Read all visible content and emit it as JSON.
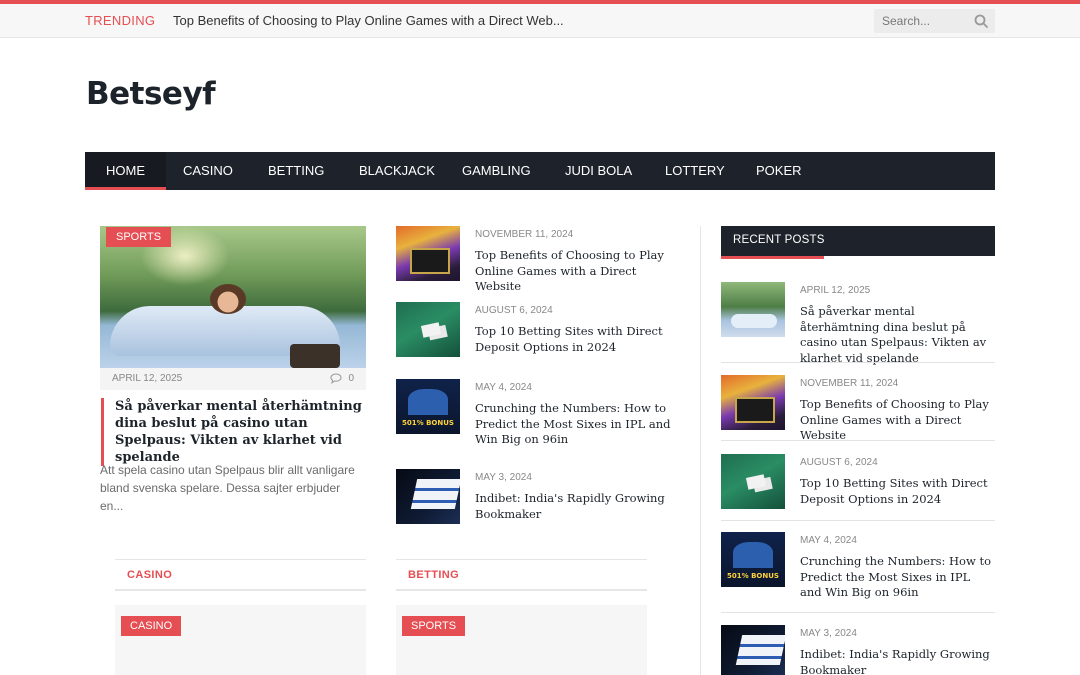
{
  "topbar": {
    "trending_label": "TRENDING",
    "trending_text": "Top Benefits of Choosing to Play Online Games with a Direct Web...",
    "search_placeholder": "Search..."
  },
  "site": {
    "logo": "Betseyf"
  },
  "nav": {
    "items": [
      "HOME",
      "CASINO",
      "BETTING",
      "BLACKJACK",
      "GAMBLING",
      "JUDI BOLA",
      "LOTTERY",
      "POKER"
    ],
    "active": "HOME"
  },
  "featured": {
    "category": "SPORTS",
    "date": "APRIL 12, 2025",
    "comments": "0",
    "title": "Så påverkar mental återhämtning dina beslut på casino utan Spelpaus: Vikten av klarhet vid spelande",
    "excerpt": "Att spela casino utan Spelpaus blir allt vanligare bland svenska spelare. Dessa sajter erbjuder en..."
  },
  "middle_posts": [
    {
      "date": "NOVEMBER 11, 2024",
      "title": "Top Benefits of Choosing to Play Online Games with a Direct Website",
      "thumb": "games"
    },
    {
      "date": "AUGUST 6, 2024",
      "title": "Top 10 Betting Sites with Direct Deposit Options in 2024",
      "thumb": "table"
    },
    {
      "date": "MAY 4, 2024",
      "title": "Crunching the Numbers: How to Predict the Most Sixes in IPL and Win Big on 96in",
      "thumb": "ipl"
    },
    {
      "date": "MAY 3, 2024",
      "title": "Indibet: India's Rapidly Growing Bookmaker",
      "thumb": "indibet"
    }
  ],
  "sidebar": {
    "widget_title": "RECENT POSTS",
    "posts": [
      {
        "date": "APRIL 12, 2025",
        "title": "Så påverkar mental återhämtning dina beslut på casino utan Spelpaus: Vikten av klarhet vid spelande",
        "thumb": "sleep"
      },
      {
        "date": "NOVEMBER 11, 2024",
        "title": "Top Benefits of Choosing to Play Online Games with a Direct Website",
        "thumb": "games"
      },
      {
        "date": "AUGUST 6, 2024",
        "title": "Top 10 Betting Sites with Direct Deposit Options in 2024",
        "thumb": "table"
      },
      {
        "date": "MAY 4, 2024",
        "title": "Crunching the Numbers: How to Predict the Most Sixes in IPL and Win Big on 96in",
        "thumb": "ipl"
      },
      {
        "date": "MAY 3, 2024",
        "title": "Indibet: India's Rapidly Growing Bookmaker",
        "thumb": "indibet"
      }
    ]
  },
  "category_blocks": [
    {
      "heading": "CASINO",
      "tag": "CASINO"
    },
    {
      "heading": "BETTING",
      "tag": "SPORTS"
    }
  ],
  "colors": {
    "accent": "#e54e53",
    "nav_bg": "#1e232b"
  },
  "icons": {
    "search": "search-icon",
    "comment": "comment-icon"
  }
}
